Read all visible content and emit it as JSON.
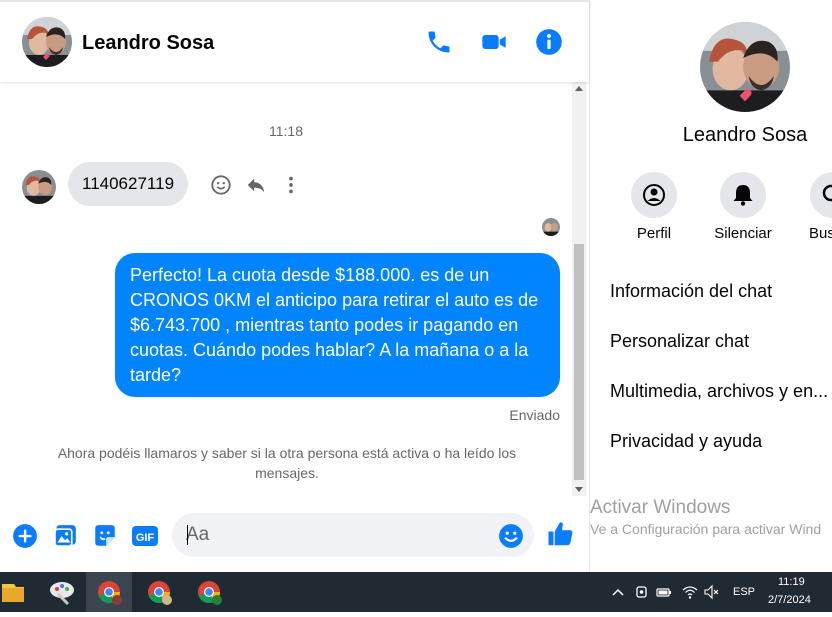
{
  "header": {
    "contact_name": "Leandro Sosa",
    "icons": [
      "phone-icon",
      "video-icon",
      "info-icon"
    ]
  },
  "conversation": {
    "timestamp": "11:18",
    "incoming_message": "1140627119",
    "message_actions": [
      "react-icon",
      "reply-icon",
      "more-icon"
    ],
    "outgoing_message": "Perfecto! La cuota desde $188.000. es de un CRONOS 0KM el anticipo para retirar el auto es de $6.743.700 , mientras tanto podes ir pagando en cuotas. Cuándo podes hablar? A la mañana o a la tarde?",
    "status": "Enviado",
    "notice": "Ahora podéis llamaros y saber si la otra persona está activa o ha leído los mensajes."
  },
  "composer": {
    "placeholder": "Aa",
    "icons": [
      "add-icon",
      "gallery-icon",
      "sticker-icon",
      "gif-icon",
      "emoji-icon",
      "like-icon"
    ],
    "gif_label": "GIF"
  },
  "info_panel": {
    "name": "Leandro Sosa",
    "actions": [
      {
        "label": "Perfil",
        "icon": "profile-icon"
      },
      {
        "label": "Silenciar",
        "icon": "bell-icon"
      },
      {
        "label": "Bus",
        "icon": "search-icon"
      }
    ],
    "menu": [
      "Información del chat",
      "Personalizar chat",
      "Multimedia, archivos y en...",
      "Privacidad y ayuda"
    ]
  },
  "watermark": {
    "title": "Activar Windows",
    "subtitle": "Ve a Configuración para activar Wind"
  },
  "taskbar": {
    "language": "ESP",
    "time": "11:19",
    "date": "2/7/2024"
  },
  "colors": {
    "accent": "#0084ff",
    "icon_blue": "#0a7cff",
    "incoming_bubble": "#e4e6eb",
    "taskbar": "#1f2a33"
  }
}
